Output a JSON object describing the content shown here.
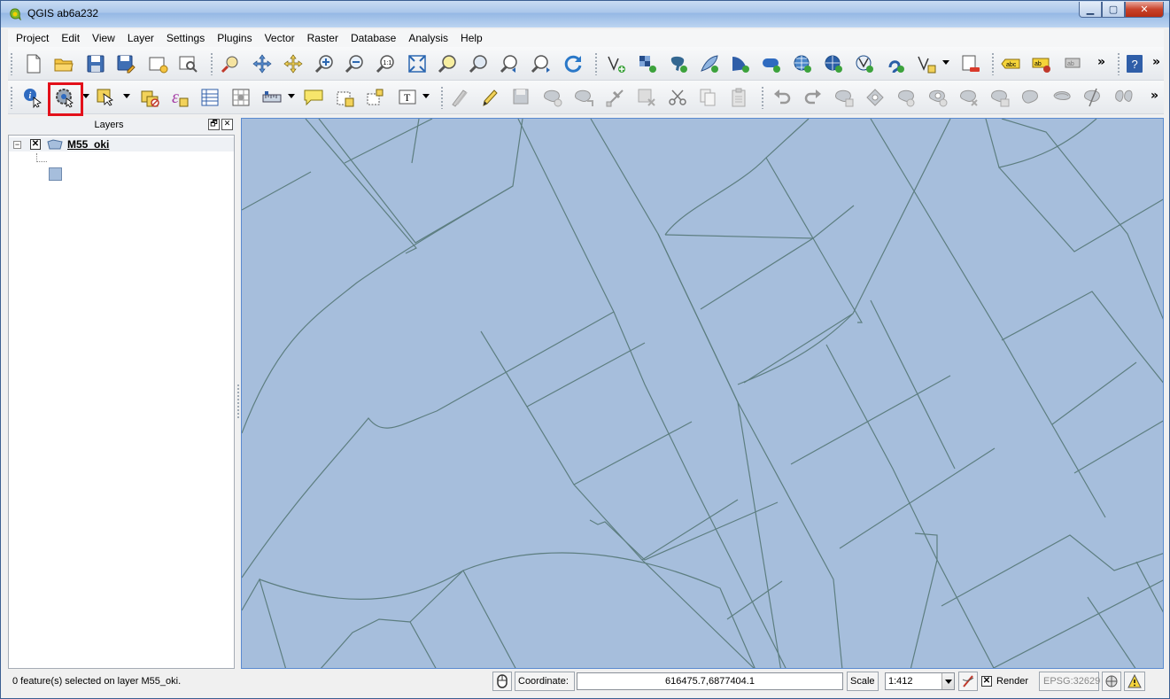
{
  "window": {
    "title": "QGIS ab6a232",
    "app_icon": "qgis-logo-icon",
    "minimize_glyph": "▁",
    "maximize_glyph": "▢",
    "close_glyph": "✕"
  },
  "menubar": {
    "items": [
      "Project",
      "Edit",
      "View",
      "Layer",
      "Settings",
      "Plugins",
      "Vector",
      "Raster",
      "Database",
      "Analysis",
      "Help"
    ]
  },
  "toolbar1": {
    "icons": [
      "new-project-icon",
      "open-project-icon",
      "save-project-icon",
      "save-as-icon",
      "new-print-composer-icon",
      "composer-manager-icon",
      "pan-map-icon",
      "pan-to-selection-icon",
      "pan-selected-icon",
      "zoom-in-icon",
      "zoom-out-icon",
      "zoom-native-icon",
      "zoom-full-icon",
      "zoom-to-selection-icon",
      "zoom-to-layer-icon",
      "zoom-last-icon",
      "zoom-next-icon",
      "refresh-icon",
      "add-vector-layer-icon",
      "add-raster-layer-icon",
      "add-postgis-layer-icon",
      "add-spatialite-layer-icon",
      "add-mssql-layer-icon",
      "add-oracle-layer-icon",
      "add-wms-layer-icon",
      "add-wcs-layer-icon",
      "add-wfs-layer-icon",
      "add-delimited-text-icon",
      "new-shapefile-icon",
      "remove-layer-icon",
      "label-icon",
      "layer-labeling-icon",
      "pin-labels-icon",
      "help-icon"
    ],
    "overflow": "»"
  },
  "toolbar2": {
    "icons": [
      "identify-features-icon",
      "run-feature-action-icon",
      "select-features-icon",
      "deselect-all-icon",
      "expression-select-icon",
      "attribute-table-icon",
      "field-calculator-icon",
      "measure-line-icon",
      "map-tips-icon",
      "new-bookmark-icon",
      "show-bookmarks-icon",
      "text-annotation-icon",
      "current-edits-icon",
      "toggle-editing-icon",
      "save-layer-edits-icon",
      "add-feature-icon",
      "move-feature-icon",
      "node-tool-icon",
      "delete-selected-icon",
      "cut-features-icon",
      "copy-features-icon",
      "paste-features-icon",
      "undo-icon",
      "redo-icon",
      "simplify-feature-icon",
      "add-ring-icon",
      "add-part-icon",
      "fill-ring-icon",
      "delete-ring-icon",
      "delete-part-icon",
      "reshape-features-icon",
      "offset-curve-icon",
      "split-features-icon",
      "split-parts-icon",
      "merge-selected-icon"
    ],
    "overflow": "»"
  },
  "layers_panel": {
    "title": "Layers",
    "float_glyph": "🗗",
    "close_glyph": "✕",
    "layers": [
      {
        "name": "M55_oki",
        "visible": true,
        "expanded": true,
        "type_icon": "polygon-layer-icon",
        "fill_color": "#a6bedc"
      }
    ]
  },
  "map": {
    "fill_color": "#a6bedc",
    "stroke_color": "#5d7e80"
  },
  "statusbar": {
    "message": "0 feature(s) selected on layer M55_oki.",
    "coordinate_label": "Coordinate:",
    "coordinate_value": "616475.7,6877404.1",
    "scale_label": "Scale",
    "scale_value": "1:412",
    "render_label": "Render",
    "render_checked": true,
    "crs": "EPSG:32629"
  }
}
